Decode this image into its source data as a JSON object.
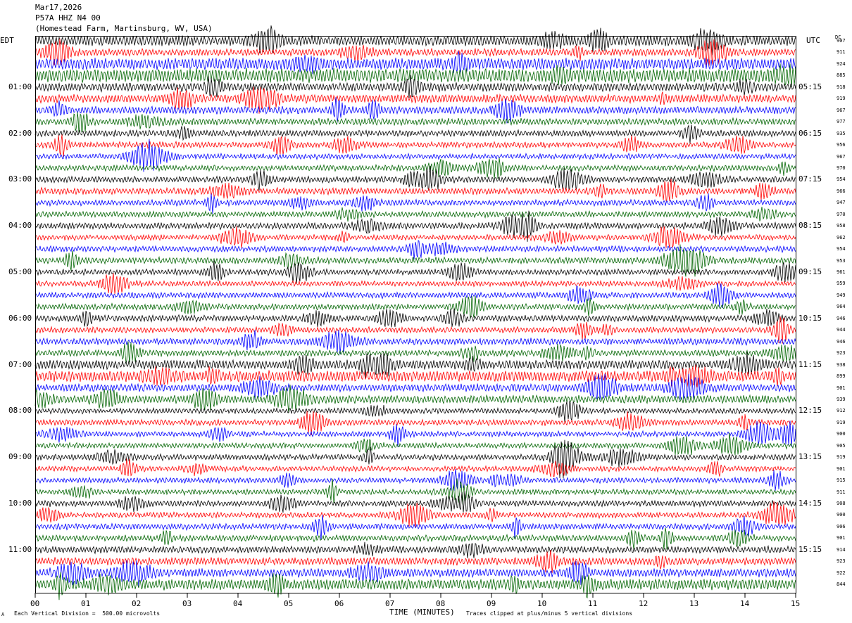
{
  "header": {
    "date": "Mar17,2026",
    "station": "P57A HHZ N4 00",
    "location": "(Homestead Farm, Martinsburg, WV, USA)"
  },
  "left_tz": "EDT",
  "right_tz": "UTC",
  "dc_header": "DC",
  "footer": {
    "scale": "Each Vertical Division =  500.00 microvolts",
    "clip": "Traces clipped at plus/minus 5 vertical divisions",
    "small": "A"
  },
  "chart_data": {
    "type": "line",
    "xlabel": "TIME (MINUTES)",
    "xlim": [
      0,
      15
    ],
    "x_ticks": [
      "00",
      "01",
      "02",
      "03",
      "04",
      "05",
      "06",
      "07",
      "08",
      "09",
      "10",
      "11",
      "12",
      "13",
      "14",
      "15"
    ],
    "trace_colors": [
      "#000000",
      "#ff0000",
      "#0000ff",
      "#006400"
    ],
    "hour_labels_left": [
      "01:00",
      "02:00",
      "03:00",
      "04:00",
      "05:00",
      "06:00",
      "07:00",
      "08:00",
      "09:00",
      "10:00",
      "11:00"
    ],
    "hour_labels_right": [
      "05:15",
      "06:15",
      "07:15",
      "08:15",
      "09:15",
      "10:15",
      "11:15",
      "12:15",
      "13:15",
      "14:15",
      "15:15"
    ],
    "dc_offsets": [
      "907",
      "911",
      "924",
      "885",
      "918",
      "919",
      "967",
      "977",
      "935",
      "956",
      "967",
      "970",
      "954",
      "966",
      "947",
      "970",
      "958",
      "962",
      "954",
      "953",
      "961",
      "959",
      "949",
      "964",
      "946",
      "944",
      "946",
      "923",
      "938",
      "899",
      "901",
      "939",
      "912",
      "919",
      "900",
      "905",
      "919",
      "901",
      "915",
      "911",
      "908",
      "900",
      "906",
      "901",
      "914",
      "923",
      "922",
      "844"
    ],
    "trace_activity": [
      2.2,
      1.5,
      2.6,
      3.1,
      1.8,
      1.8,
      1.6,
      1.4,
      1.3,
      1.2,
      1.1,
      1.2,
      1.3,
      1.4,
      1.2,
      1.2,
      1.3,
      1.1,
      1.2,
      1.3,
      1.2,
      1.1,
      1.2,
      1.2,
      1.3,
      1.2,
      1.4,
      1.3,
      2.0,
      2.4,
      1.6,
      1.7,
      1.1,
      1.2,
      1.1,
      1.1,
      1.2,
      1.1,
      1.1,
      1.1,
      1.2,
      1.1,
      1.2,
      1.3,
      1.4,
      1.6,
      1.8,
      2.4
    ],
    "clip_divisions": 5,
    "grid": false
  }
}
